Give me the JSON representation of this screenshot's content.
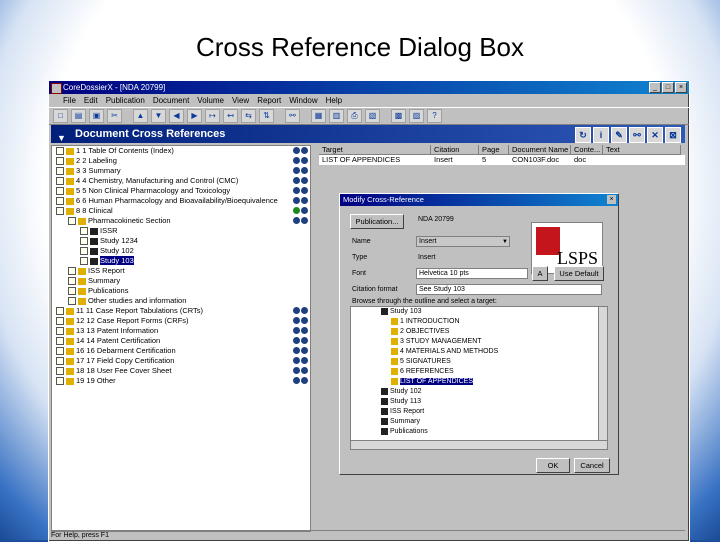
{
  "slide_title": "Cross Reference Dialog Box",
  "window": {
    "title": "CoreDossierX - [NDA 20799]"
  },
  "menu": [
    "File",
    "Edit",
    "Publication",
    "Document",
    "Volume",
    "View",
    "Report",
    "Window",
    "Help"
  ],
  "doc_header": {
    "title": "Document Cross References"
  },
  "tree_items": [
    {
      "indent": 0,
      "label": "1 1 Table Of Contents (Index)",
      "status": 2
    },
    {
      "indent": 0,
      "label": "2 2 Labeling",
      "status": 2
    },
    {
      "indent": 0,
      "label": "3 3 Summary",
      "status": 2
    },
    {
      "indent": 0,
      "label": "4 4 Chemistry, Manufacturing and Control (CMC)",
      "status": 2
    },
    {
      "indent": 0,
      "label": "5 5 Non Clinical Pharmacology and Toxicology",
      "status": 2
    },
    {
      "indent": 0,
      "label": "6 6 Human Pharmacology and Bioavailability/Bioequivalence",
      "status": 2
    },
    {
      "indent": 0,
      "label": "8 8 Clinical",
      "status": 2
    },
    {
      "indent": 1,
      "label": "Pharmacokinetic Section",
      "status": 2
    },
    {
      "indent": 2,
      "label": "ISSR",
      "status": 0
    },
    {
      "indent": 2,
      "label": "Study 1234",
      "status": 0
    },
    {
      "indent": 2,
      "label": "Study 102",
      "status": 0
    },
    {
      "indent": 2,
      "label": "Study 103",
      "status": 0,
      "selected": true
    },
    {
      "indent": 1,
      "label": "ISS Report",
      "status": 0
    },
    {
      "indent": 1,
      "label": "Summary",
      "status": 0
    },
    {
      "indent": 1,
      "label": "Publications",
      "status": 0
    },
    {
      "indent": 1,
      "label": "Other studies and information",
      "status": 0
    },
    {
      "indent": 0,
      "label": "11 11 Case Report Tabulations (CRTs)",
      "status": 2
    },
    {
      "indent": 0,
      "label": "12 12 Case Report Forms (CRFs)",
      "status": 2
    },
    {
      "indent": 0,
      "label": "13 13 Patent Information",
      "status": 2
    },
    {
      "indent": 0,
      "label": "14 14 Patent Certification",
      "status": 2
    },
    {
      "indent": 0,
      "label": "16 16 Debarment Certification",
      "status": 2
    },
    {
      "indent": 0,
      "label": "17 17 Field Copy Certification",
      "status": 2
    },
    {
      "indent": 0,
      "label": "18 18 User Fee Cover Sheet",
      "status": 2
    },
    {
      "indent": 0,
      "label": "19 19 Other",
      "status": 2
    }
  ],
  "ref_table": {
    "columns": [
      "Target",
      "Citation",
      "Page",
      "Document Name",
      "Conte...",
      "Text"
    ],
    "rows": [
      [
        "LIST OF APPENDICES",
        "Insert",
        "5",
        "CON103F.doc",
        "doc",
        ""
      ]
    ]
  },
  "dialog": {
    "title": "Modify Cross-Reference",
    "publication_btn": "Publication...",
    "nda": "NDA 20799",
    "labels": {
      "name": "Name",
      "type": "Type",
      "font": "Font",
      "citation_format": "Citation format"
    },
    "name_value": "Insert",
    "type_value": "Insert",
    "font_value": "Helvetica 10 pts",
    "citation_value": "See Study 103",
    "a_btn": "A",
    "use_default": "Use Default",
    "browse_label": "Browse through the outline and select a target:",
    "logo_text": "LSPS",
    "subtree": [
      {
        "indent": 1,
        "label": "Study 103"
      },
      {
        "indent": 2,
        "label": "1 INTRODUCTION"
      },
      {
        "indent": 2,
        "label": "2 OBJECTIVES"
      },
      {
        "indent": 2,
        "label": "3 STUDY MANAGEMENT"
      },
      {
        "indent": 2,
        "label": "4 MATERIALS AND METHODS"
      },
      {
        "indent": 2,
        "label": "5 SIGNATURES"
      },
      {
        "indent": 2,
        "label": "6 REFERENCES"
      },
      {
        "indent": 2,
        "label": "LIST OF APPENDICES",
        "selected": true
      },
      {
        "indent": 1,
        "label": "Study 102"
      },
      {
        "indent": 1,
        "label": "Study 113"
      },
      {
        "indent": 1,
        "label": "ISS Report"
      },
      {
        "indent": 1,
        "label": "Summary"
      },
      {
        "indent": 1,
        "label": "Publications"
      }
    ],
    "ok": "OK",
    "cancel": "Cancel"
  },
  "status_text": "For Help, press F1"
}
